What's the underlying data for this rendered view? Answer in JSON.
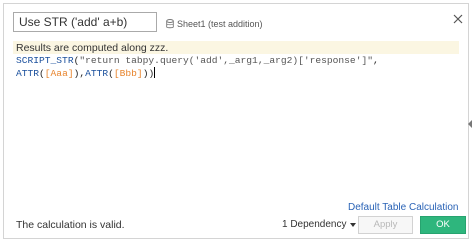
{
  "calc": {
    "name": "Use STR ('add' a+b)",
    "sheet_ref": "Sheet1 (test addition)"
  },
  "editor": {
    "hint": "Results are computed along zzz.",
    "line1_fn": "SCRIPT_STR",
    "line1_open": "(",
    "line1_str": "\"return tabpy.query('add',_arg1,_arg2)['response']\"",
    "line1_comma": ",",
    "line2_fn1": "ATTR",
    "line2_open1": "(",
    "line2_field1": "[Aaa]",
    "line2_mid": "),",
    "line2_fn2": "ATTR",
    "line2_open2": "(",
    "line2_field2": "[Bbb]",
    "line2_close": "))"
  },
  "footer": {
    "default_calc_link": "Default Table Calculation",
    "status": "The calculation is valid.",
    "dependency": "1 Dependency",
    "apply_label": "Apply",
    "ok_label": "OK"
  },
  "colors": {
    "accent": "#2eb67d",
    "link": "#2a63b6",
    "field": "#e8852e",
    "function": "#1a4f9c",
    "hint_background": "#fbf6e2"
  },
  "icons": {
    "sheet": "database-icon",
    "close": "close-icon",
    "resize": "resize-handle-icon",
    "dependency": "chevron-down-icon"
  }
}
